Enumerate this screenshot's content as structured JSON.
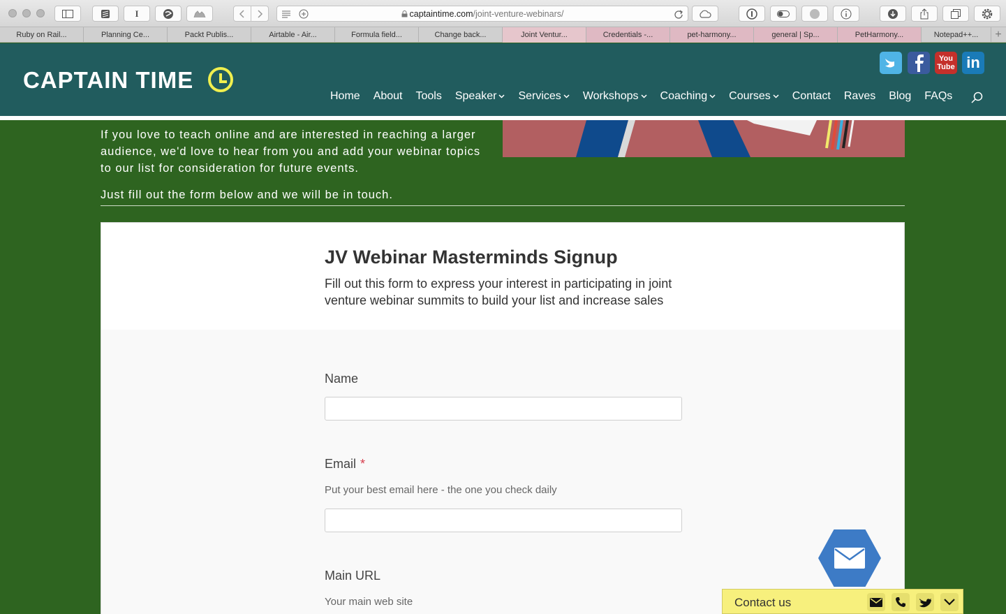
{
  "browser": {
    "url_domain": "captaintime.com",
    "url_path": "/joint-venture-webinars/",
    "tabs": [
      {
        "label": "Ruby on Rail..."
      },
      {
        "label": "Planning Ce..."
      },
      {
        "label": "Packt Publis..."
      },
      {
        "label": "Airtable - Air..."
      },
      {
        "label": "Formula field..."
      },
      {
        "label": "Change back..."
      },
      {
        "label": "Joint Ventur..."
      },
      {
        "label": "Credentials -..."
      },
      {
        "label": "pet-harmony..."
      },
      {
        "label": "general | Sp..."
      },
      {
        "label": "PetHarmony..."
      },
      {
        "label": "Notepad++..."
      }
    ],
    "reader_glyph": "I",
    "add_tab_glyph": "+"
  },
  "header": {
    "logo_text": "CAPTAIN TIME",
    "social": {
      "youtube_top": "You",
      "youtube_bottom": "Tube",
      "linkedin": "in"
    },
    "nav": [
      {
        "label": "Home"
      },
      {
        "label": "About"
      },
      {
        "label": "Tools"
      },
      {
        "label": "Speaker"
      },
      {
        "label": "Services"
      },
      {
        "label": "Workshops"
      },
      {
        "label": "Coaching"
      },
      {
        "label": "Courses"
      },
      {
        "label": "Contact"
      },
      {
        "label": "Raves"
      },
      {
        "label": "Blog"
      },
      {
        "label": "FAQs"
      }
    ]
  },
  "content": {
    "intro": "If you love to teach online and are interested in reaching a larger audience, we'd love to hear from you and add your webinar topics to our list for consideration for future events.",
    "fill_line": "Just fill out the form below and we will be in touch."
  },
  "form": {
    "title": "JV Webinar Masterminds Signup",
    "description": "Fill out this form to express your interest in participating in joint venture webinar summits to build your list and increase sales",
    "fields": {
      "name": {
        "label": "Name",
        "value": ""
      },
      "email": {
        "label": "Email",
        "required_mark": "*",
        "help": "Put your best email here - the one you check daily",
        "value": ""
      },
      "url": {
        "label": "Main URL",
        "help": "Your main web site"
      }
    }
  },
  "widget": {
    "contact_label": "Contact us"
  }
}
